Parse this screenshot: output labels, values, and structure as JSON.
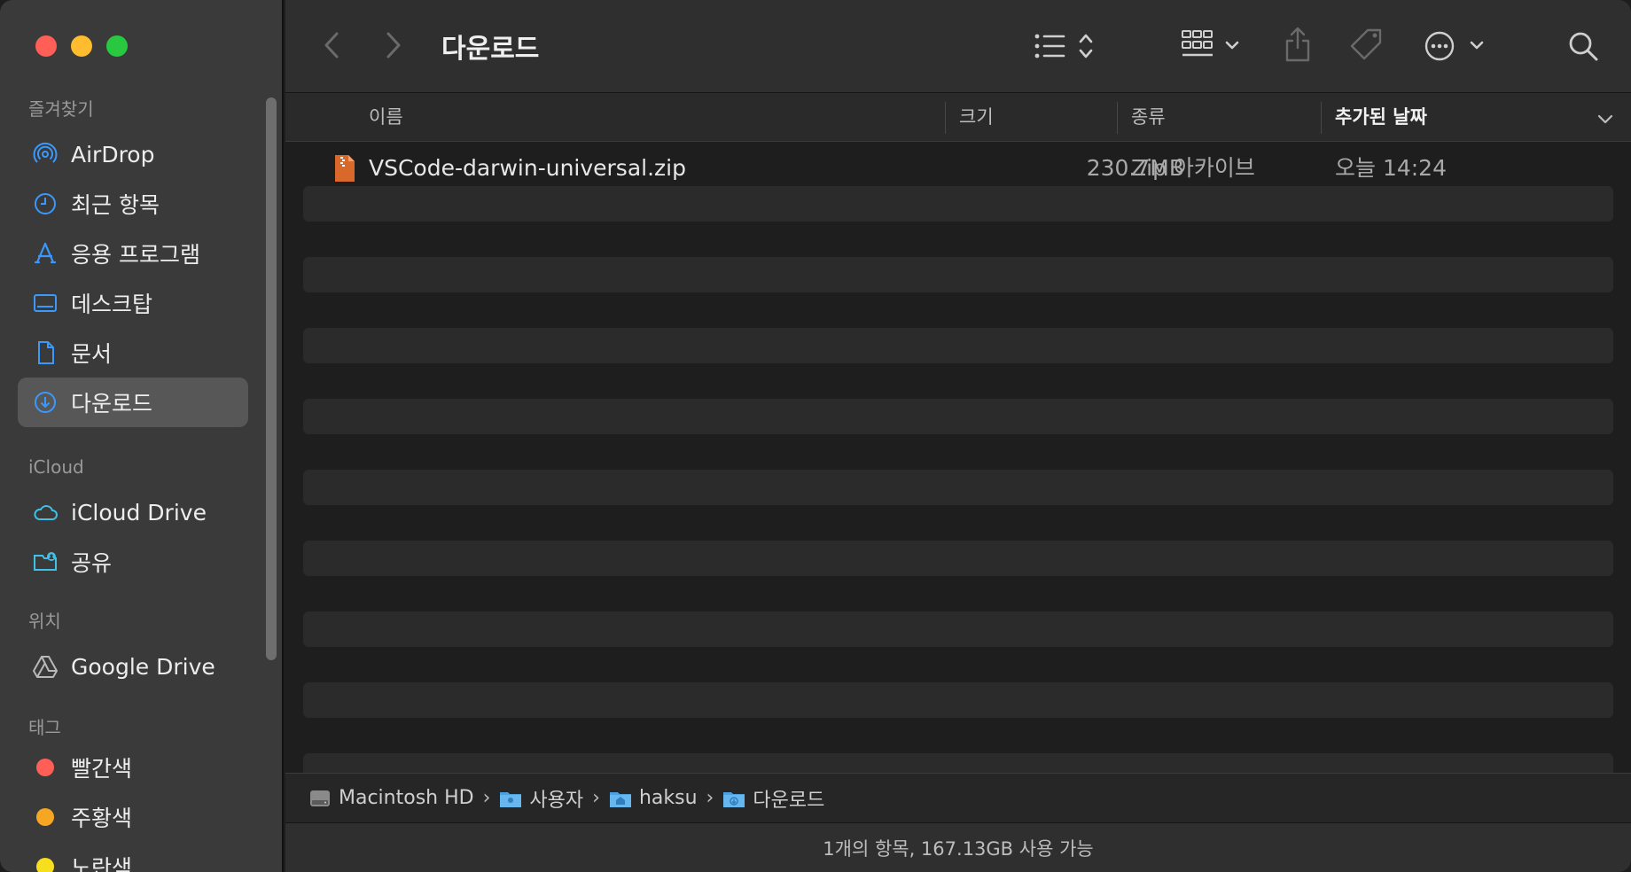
{
  "window": {
    "title": "다운로드"
  },
  "sidebar": {
    "sections": [
      {
        "header": "즐겨찾기",
        "items": [
          {
            "label": "AirDrop",
            "icon": "airdrop-icon"
          },
          {
            "label": "최근 항목",
            "icon": "clock-icon"
          },
          {
            "label": "응용 프로그램",
            "icon": "applications-icon"
          },
          {
            "label": "데스크탑",
            "icon": "desktop-icon"
          },
          {
            "label": "문서",
            "icon": "document-icon"
          },
          {
            "label": "다운로드",
            "icon": "downloads-icon",
            "selected": true
          }
        ]
      },
      {
        "header": "iCloud",
        "items": [
          {
            "label": "iCloud Drive",
            "icon": "cloud-icon"
          },
          {
            "label": "공유",
            "icon": "shared-folder-icon"
          }
        ]
      },
      {
        "header": "위치",
        "items": [
          {
            "label": "Google Drive",
            "icon": "drive-icon"
          }
        ]
      },
      {
        "header": "태그",
        "items": [
          {
            "label": "빨간색",
            "color": "#ff5f57"
          },
          {
            "label": "주황색",
            "color": "#f6a623"
          },
          {
            "label": "노란색",
            "color": "#f7df1e"
          }
        ]
      }
    ]
  },
  "columns": {
    "name": "이름",
    "size": "크기",
    "kind": "종류",
    "date_added": "추가된 날짜"
  },
  "files": [
    {
      "name": "VSCode-darwin-universal.zip",
      "size": "230.7MB",
      "kind": "Zip 아카이브",
      "date_added": "오늘 14:24"
    }
  ],
  "pathbar": [
    {
      "label": "Macintosh HD",
      "icon": "hard-drive-icon"
    },
    {
      "label": "사용자",
      "icon": "folder-icon"
    },
    {
      "label": "haksu",
      "icon": "home-folder-icon"
    },
    {
      "label": "다운로드",
      "icon": "downloads-folder-icon"
    }
  ],
  "status": {
    "text": "1개의 항목, 167.13GB 사용 가능"
  },
  "colors": {
    "accent": "#3b99fc",
    "sidebar_icon": "#3b99fc"
  }
}
